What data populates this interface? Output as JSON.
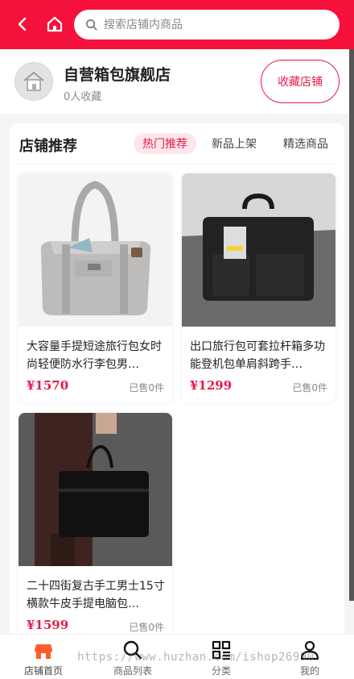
{
  "search": {
    "placeholder": "搜索店铺内商品"
  },
  "store": {
    "name": "自营箱包旗舰店",
    "fav_count": "0人收藏",
    "fav_button": "收藏店铺"
  },
  "section": {
    "title": "店铺推荐",
    "tabs": [
      {
        "label": "热门推荐",
        "active": true
      },
      {
        "label": "新品上架",
        "active": false
      },
      {
        "label": "精选商品",
        "active": false
      }
    ]
  },
  "products": [
    {
      "title": "大容量手提短途旅行包女时尚轻便防水行李包男…",
      "price": "¥1570",
      "sold": "已售0件"
    },
    {
      "title": "出口旅行包可套拉杆箱多功能登机包单肩斜跨手…",
      "price": "¥1299",
      "sold": "已售0件"
    },
    {
      "title": "二十四街复古手工男士15寸横款牛皮手提电脑包…",
      "price": "¥1599",
      "sold": "已售0件"
    }
  ],
  "tabbar": {
    "items": [
      {
        "label": "店铺首页",
        "icon": "store-home-icon"
      },
      {
        "label": "商品列表",
        "icon": "search-icon"
      },
      {
        "label": "分类",
        "icon": "category-grid-icon"
      },
      {
        "label": "我的",
        "icon": "user-icon"
      }
    ]
  },
  "watermark": "https://www.huzhan.com/ishop26990",
  "colors": {
    "brand": "#f5113c",
    "accent": "#e8194a"
  }
}
